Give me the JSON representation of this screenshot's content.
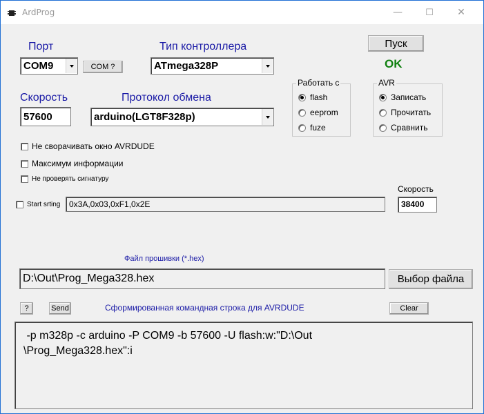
{
  "window": {
    "title": "ArdProg",
    "minimize_glyph": "—",
    "maximize_glyph": "☐",
    "close_glyph": "✕",
    "icon": "chip-icon"
  },
  "port": {
    "label": "Порт",
    "value": "COM9",
    "detect_label": "COM ?"
  },
  "controller": {
    "label": "Тип контроллера",
    "value": "ATmega328P"
  },
  "start": {
    "label": "Пуск",
    "status": "OK",
    "status_color": "#108010"
  },
  "speed": {
    "label": "Скорость",
    "value": "57600"
  },
  "protocol": {
    "label": "Протокол обмена",
    "value": "arduino(LGT8F328p)"
  },
  "memory_group": {
    "title": "Работать с",
    "options": [
      "flash",
      "eeprom",
      "fuze"
    ],
    "selected": "flash"
  },
  "avr_group": {
    "title": "AVR",
    "options": [
      "Записать",
      "Прочитать",
      "Сравнить"
    ],
    "selected": "Записать"
  },
  "options": {
    "no_minimize": "Не сворачивать окно AVRDUDE",
    "max_info": "Максимум информации",
    "no_signature": "Не проверять сигнатуру"
  },
  "start_string": {
    "label": "Start srting",
    "value": "0x3A,0x03,0xF1,0x2E"
  },
  "speed2": {
    "label": "Скорость",
    "value": "38400"
  },
  "firmware": {
    "label": "Файл прошивки (*.hex)",
    "path": "D:\\Out\\Prog_Mega328.hex",
    "choose_label": "Выбор файла"
  },
  "command": {
    "help_label": "?",
    "send_label": "Send",
    "caption": "Сформированная командная строка для AVRDUDE",
    "clear_label": "Clear",
    "output": " -p m328p -c arduino -P COM9 -b 57600 -U flash:w:\"D:\\Out\n\\Prog_Mega328.hex\":i"
  },
  "colors": {
    "label_blue": "#1a1aa6",
    "desktop_blue": "#1f6fd4"
  }
}
